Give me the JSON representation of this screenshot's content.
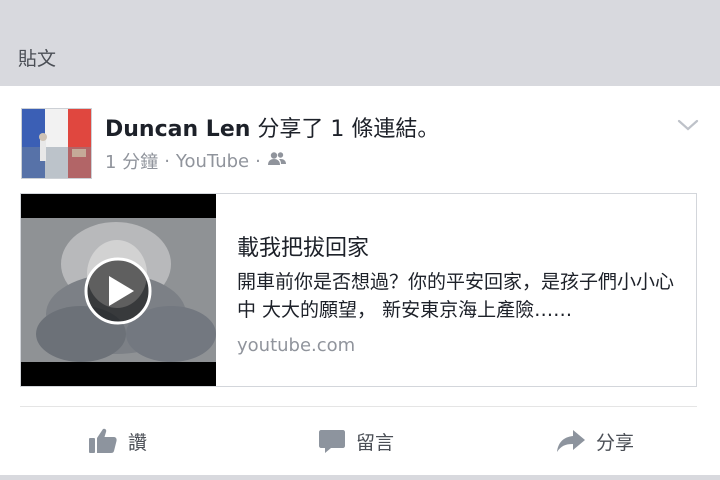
{
  "section": {
    "title": "貼文"
  },
  "post": {
    "author": "Duncan Len",
    "action_text": " 分享了 1 條連結。",
    "time": "1 分鐘",
    "separator": "·",
    "source": "YouTube",
    "audience_icon": "friends-icon"
  },
  "link": {
    "title": "載我把拔回家",
    "description": "開車前你是否想過？你的平安回家，是孩子們小小心中 大大的願望， 新安東京海上產險……",
    "domain": "youtube.com",
    "thumbnail_icon": "play-icon"
  },
  "actions": {
    "like_label": "讚",
    "comment_label": "留言",
    "share_label": "分享"
  },
  "colors": {
    "header_bg": "#d8d9de",
    "meta_text": "#90949c",
    "action_text": "#4b4f56"
  }
}
